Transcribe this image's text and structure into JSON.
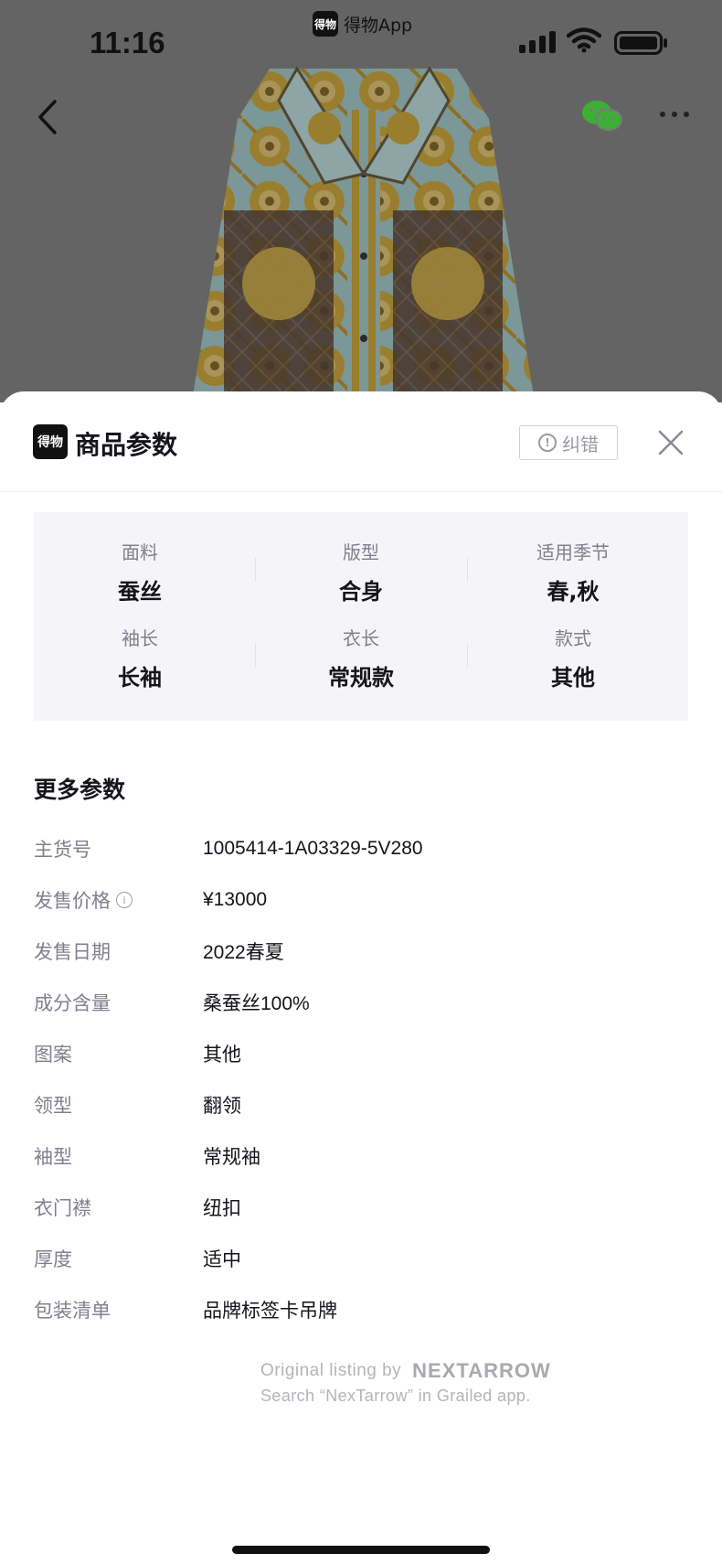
{
  "status_bar": {
    "time": "11:16",
    "app_name": "得物App",
    "app_logo_text": "得物"
  },
  "nav": {
    "back_icon": "chevron-left-icon",
    "share_icon": "wechat-icon",
    "more_icon": "more-dots-icon"
  },
  "sheet": {
    "logo_text": "得物",
    "title": "商品参数",
    "report_label": "纠错",
    "close_icon": "close-icon"
  },
  "specs": [
    {
      "key": "面料",
      "value": "蚕丝"
    },
    {
      "key": "版型",
      "value": "合身"
    },
    {
      "key": "适用季节",
      "value": "春,秋"
    },
    {
      "key": "袖长",
      "value": "长袖"
    },
    {
      "key": "衣长",
      "value": "常规款"
    },
    {
      "key": "款式",
      "value": "其他"
    }
  ],
  "more_params": {
    "title": "更多参数",
    "rows": [
      {
        "label": "主货号",
        "value": "1005414-1A03329-5V280"
      },
      {
        "label": "发售价格",
        "value": "¥13000"
      },
      {
        "label": "发售日期",
        "value": "2022春夏"
      },
      {
        "label": "成分含量",
        "value": "桑蚕丝100%"
      },
      {
        "label": "图案",
        "value": "其他"
      },
      {
        "label": "领型",
        "value": "翻领"
      },
      {
        "label": "袖型",
        "value": "常规袖"
      },
      {
        "label": "衣门襟",
        "value": "纽扣"
      },
      {
        "label": "厚度",
        "value": "适中"
      },
      {
        "label": "包装清单",
        "value": "品牌标签卡吊牌"
      }
    ]
  },
  "watermark": {
    "line1": "Original listing by",
    "brand": "NEXTARROW",
    "line2": "Search “NexTarrow” in Grailed app."
  },
  "colors": {
    "accent_green": "#3cb034",
    "text_primary": "#14151a",
    "text_secondary": "#7f7f8e",
    "panel_bg": "#f5f5f9"
  }
}
